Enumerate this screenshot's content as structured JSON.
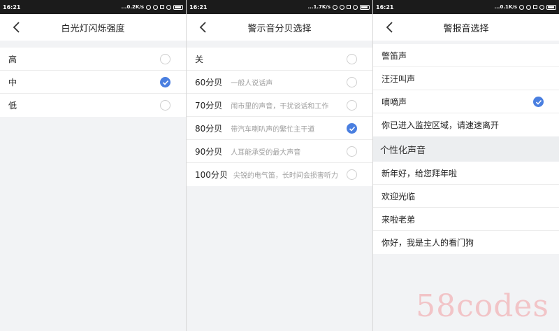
{
  "panels": [
    {
      "status": {
        "time": "16:21",
        "info": "...0.2K/s"
      },
      "title": "白光灯闪烁强度",
      "options": [
        {
          "label": "高",
          "selected": false
        },
        {
          "label": "中",
          "selected": true
        },
        {
          "label": "低",
          "selected": false
        }
      ]
    },
    {
      "status": {
        "time": "16:21",
        "info": "...1.7K/s"
      },
      "title": "警示音分贝选择",
      "options": [
        {
          "label": "关",
          "desc": "",
          "selected": false
        },
        {
          "label": "60分贝",
          "desc": "一般人说话声",
          "selected": false
        },
        {
          "label": "70分贝",
          "desc": "闹市里的声音，干扰谈话和工作",
          "selected": false
        },
        {
          "label": "80分贝",
          "desc": "带汽车喇叭声的繁忙主干道",
          "selected": true
        },
        {
          "label": "90分贝",
          "desc": "人耳能承受的最大声音",
          "selected": false
        },
        {
          "label": "100分贝",
          "desc": "尖锐的电气笛，长时间会损害听力",
          "selected": false
        }
      ]
    },
    {
      "status": {
        "time": "16:21",
        "info": "...0.1K/s"
      },
      "title": "警报音选择",
      "options": [
        {
          "label": "警笛声",
          "selected": false
        },
        {
          "label": "汪汪叫声",
          "selected": false
        },
        {
          "label": "嘀嘀声",
          "selected": true
        },
        {
          "label": "你已进入监控区域，请速速离开",
          "selected": false
        }
      ],
      "section_title": "个性化声音",
      "custom_options": [
        {
          "label": "新年好，给您拜年啦"
        },
        {
          "label": "欢迎光临"
        },
        {
          "label": "来啦老弟"
        },
        {
          "label": "你好，我是主人的看门狗"
        }
      ]
    }
  ],
  "watermark": "58codes",
  "colors": {
    "accent": "#4a7fe0",
    "background": "#f2f3f5",
    "statusbar": "#1b1b1b",
    "watermark": "#f3bcc0"
  }
}
